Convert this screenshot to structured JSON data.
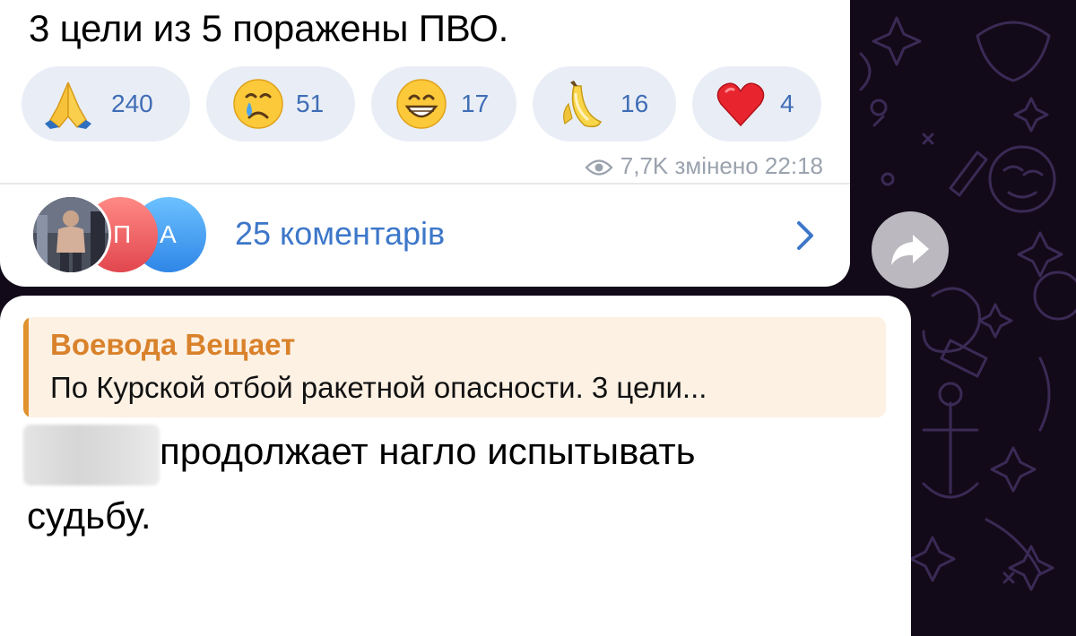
{
  "channel_post": {
    "text": "3 цели из 5 поражены ПВО.",
    "reactions": [
      {
        "emoji": "folded-hands",
        "count": "240"
      },
      {
        "emoji": "crying-face",
        "count": "51"
      },
      {
        "emoji": "grinning-face",
        "count": "17"
      },
      {
        "emoji": "banana",
        "count": "16"
      },
      {
        "emoji": "red-heart",
        "count": "4"
      }
    ],
    "views": "7,7K",
    "edited_time": "змінено 22:18",
    "comments_label": "25 коментарів",
    "commenter_avatars": [
      "photo",
      "П",
      "А"
    ]
  },
  "reply_message": {
    "quoted_author": "Воевода Вещает",
    "quoted_text": "По Курской отбой ракетной опасности. 3 цели...",
    "body_line1": "продолжает нагло испытывать",
    "body_line2": "судьбу."
  },
  "colors": {
    "wallpaper": "#120a18",
    "reaction_bg": "#e9eef6",
    "reaction_count": "#3f6db6",
    "link_blue": "#3d77c9",
    "quote_orange": "#d9822b",
    "quote_bg": "#fdf1e4"
  }
}
